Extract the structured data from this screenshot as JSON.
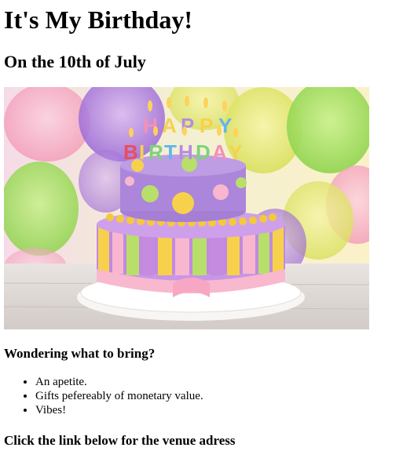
{
  "header": {
    "title": "It's My Birthday!",
    "subtitle": "On the 10th of July"
  },
  "hero_image": {
    "alt": "Birthday cake with Happy Birthday candles",
    "candle_letters_top": [
      "H",
      "A",
      "P",
      "P",
      "Y"
    ],
    "candle_letters_bottom": [
      "B",
      "I",
      "R",
      "T",
      "H",
      "D",
      "A",
      "Y"
    ]
  },
  "bring": {
    "heading": "Wondering what to bring?",
    "items": [
      "An apetite.",
      "Gifts pefereably of monetary value.",
      "Vibes!"
    ]
  },
  "venue": {
    "heading": "Click the link below for the venue adress"
  }
}
